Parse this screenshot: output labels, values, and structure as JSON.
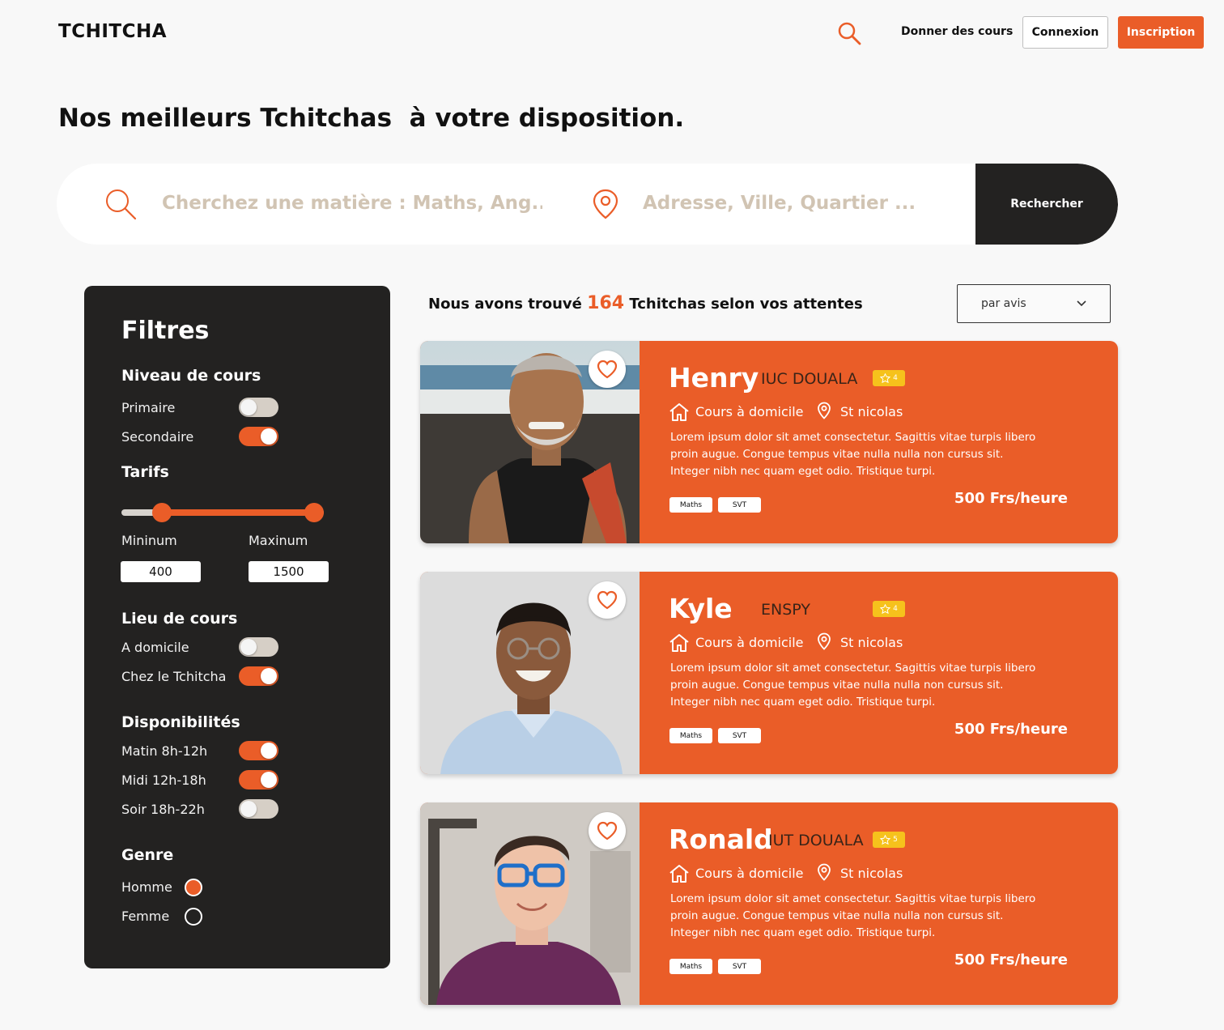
{
  "header": {
    "logo": "TCHITCHA",
    "nav_link": "Donner des cours",
    "login_label": "Connexion",
    "signup_label": "Inscription"
  },
  "page_title": "Nos meilleurs Tchitchas  à votre disposition.",
  "search": {
    "subject_placeholder": "Cherchez une matière : Maths, Ang...",
    "location_placeholder": "Adresse, Ville, Quartier ...",
    "button_label": "Rechercher"
  },
  "filters": {
    "title": "Filtres",
    "level": {
      "heading": "Niveau de cours",
      "options": [
        {
          "label": "Primaire",
          "on": false
        },
        {
          "label": "Secondaire",
          "on": true
        }
      ]
    },
    "rates": {
      "heading": "Tarifs",
      "min_label": "Mininum",
      "max_label": "Maxinum",
      "min_value": "400",
      "max_value": "1500"
    },
    "place": {
      "heading": "Lieu de cours",
      "options": [
        {
          "label": "A domicile",
          "on": false
        },
        {
          "label": "Chez le Tchitcha",
          "on": true
        }
      ]
    },
    "availability": {
      "heading": "Disponibilités",
      "options": [
        {
          "label": "Matin 8h-12h",
          "on": true
        },
        {
          "label": "Midi 12h-18h",
          "on": true
        },
        {
          "label": "Soir 18h-22h",
          "on": false
        }
      ]
    },
    "gender": {
      "heading": "Genre",
      "options": [
        {
          "label": "Homme",
          "selected": true
        },
        {
          "label": "Femme",
          "selected": false
        }
      ]
    }
  },
  "results": {
    "prefix": "Nous avons trouvé",
    "count": "164",
    "suffix": "Tchitchas selon vos attentes",
    "sort_value": "par avis"
  },
  "tutors": [
    {
      "name": "Henry",
      "school": "IUC DOUALA",
      "rating": "4",
      "mode": "Cours à domicile",
      "place": "St nicolas",
      "description": "Lorem ipsum dolor sit amet consectetur. Sagittis vitae turpis libero proin augue. Congue tempus vitae nulla nulla non cursus sit. Integer nibh nec quam eget odio. Tristique turpi.",
      "tags": [
        "Maths",
        "SVT"
      ],
      "price": "500 Frs/heure"
    },
    {
      "name": "Kyle",
      "school": "ENSPY",
      "rating": "4",
      "mode": "Cours à domicile",
      "place": "St nicolas",
      "description": "Lorem ipsum dolor sit amet consectetur. Sagittis vitae turpis libero proin augue. Congue tempus vitae nulla nulla non cursus sit. Integer nibh nec quam eget odio. Tristique turpi.",
      "tags": [
        "Maths",
        "SVT"
      ],
      "price": "500 Frs/heure"
    },
    {
      "name": "Ronald",
      "school": "IUT DOUALA",
      "rating": "5",
      "mode": "Cours à domicile",
      "place": "St nicolas",
      "description": "Lorem ipsum dolor sit amet consectetur. Sagittis vitae turpis libero proin augue. Congue tempus vitae nulla nulla non cursus sit. Integer nibh nec quam eget odio. Tristique turpi.",
      "tags": [
        "Maths",
        "SVT"
      ],
      "price": "500 Frs/heure"
    }
  ],
  "colors": {
    "accent": "#ea5d28",
    "dark": "#232221",
    "rating": "#f6c21c",
    "placeholder": "#d1c4b3"
  },
  "icons": [
    "search-icon",
    "location-pin-icon",
    "chevron-down-icon",
    "heart-icon",
    "star-icon",
    "home-icon"
  ]
}
